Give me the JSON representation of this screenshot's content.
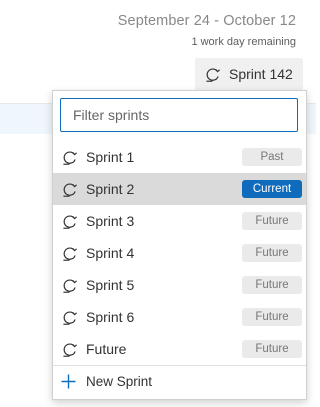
{
  "header": {
    "date_range": "September 24 - October 12",
    "days_remaining": "1 work day remaining",
    "picker_label": "Sprint 142",
    "picker_icon": "iteration-icon"
  },
  "dropdown": {
    "filter_placeholder": "Filter sprints",
    "filter_value": "",
    "items": [
      {
        "label": "Sprint 1",
        "status": "Past",
        "selected": false
      },
      {
        "label": "Sprint 2",
        "status": "Current",
        "selected": true
      },
      {
        "label": "Sprint 3",
        "status": "Future",
        "selected": false
      },
      {
        "label": "Sprint 4",
        "status": "Future",
        "selected": false
      },
      {
        "label": "Sprint 5",
        "status": "Future",
        "selected": false
      },
      {
        "label": "Sprint 6",
        "status": "Future",
        "selected": false
      },
      {
        "label": "Future",
        "status": "Future",
        "selected": false
      }
    ],
    "new_sprint_label": "New Sprint",
    "new_sprint_icon": "plus-icon"
  },
  "colors": {
    "accent": "#0f6cbd",
    "selected_row": "#dadada",
    "badge_bg": "#eaeaea"
  }
}
